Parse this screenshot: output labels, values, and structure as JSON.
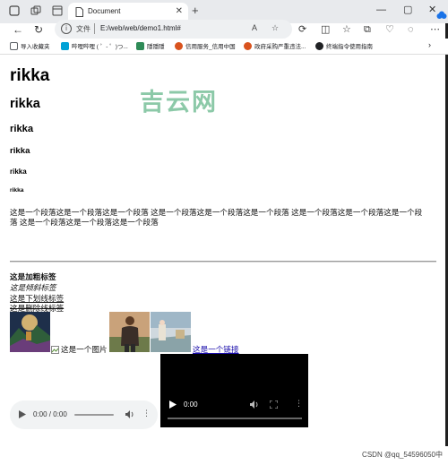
{
  "browser": {
    "tab_title": "Document",
    "omnibox_label": "文件",
    "url": "E:/web/web/demo1.html#",
    "omni_font_label": "A",
    "bookmarks": [
      {
        "label": "导入收藏夹",
        "color": "#5f6368"
      },
      {
        "label": "哔哩哔哩 ( ゜- ゜)つ...",
        "color": "#00a1d6"
      },
      {
        "label": "隱隱隱",
        "color": "#2e8b57"
      },
      {
        "label": "信用服务_信用中国",
        "color": "#d9531e"
      },
      {
        "label": "政府采购严重违法...",
        "color": "#d9531e"
      },
      {
        "label": "终端指令使用指南",
        "color": "#202124"
      }
    ]
  },
  "page": {
    "watermark": "吉云网",
    "headings": [
      "rikka",
      "rikka",
      "rikka",
      "rikka",
      "rikka",
      "rikka"
    ],
    "paragraph_line1": "这是一个段落这是一个段落这是一个段落 这是一个段落这是一个段落这是一个段落 这是一个段落这是一个段落这是一个段",
    "paragraph_line2": "落 这是一个段落这是一个段落这是一个段落",
    "bold": "这是加粗标签",
    "italic": "这是倾斜标签",
    "underline": "这是下划线标签",
    "strike": "这是删除线标签",
    "broken_image_alt": "这是一个图片",
    "link_text": "这是一个链接",
    "audio_time": "0:00 / 0:00",
    "video_time": "0:00"
  },
  "status": {
    "csdn": "CSDN @qq_54596050中"
  },
  "colors": {
    "chrome_bg": "#e8eaed",
    "watermark": "#8cc9a8",
    "link": "#1a0dab"
  }
}
